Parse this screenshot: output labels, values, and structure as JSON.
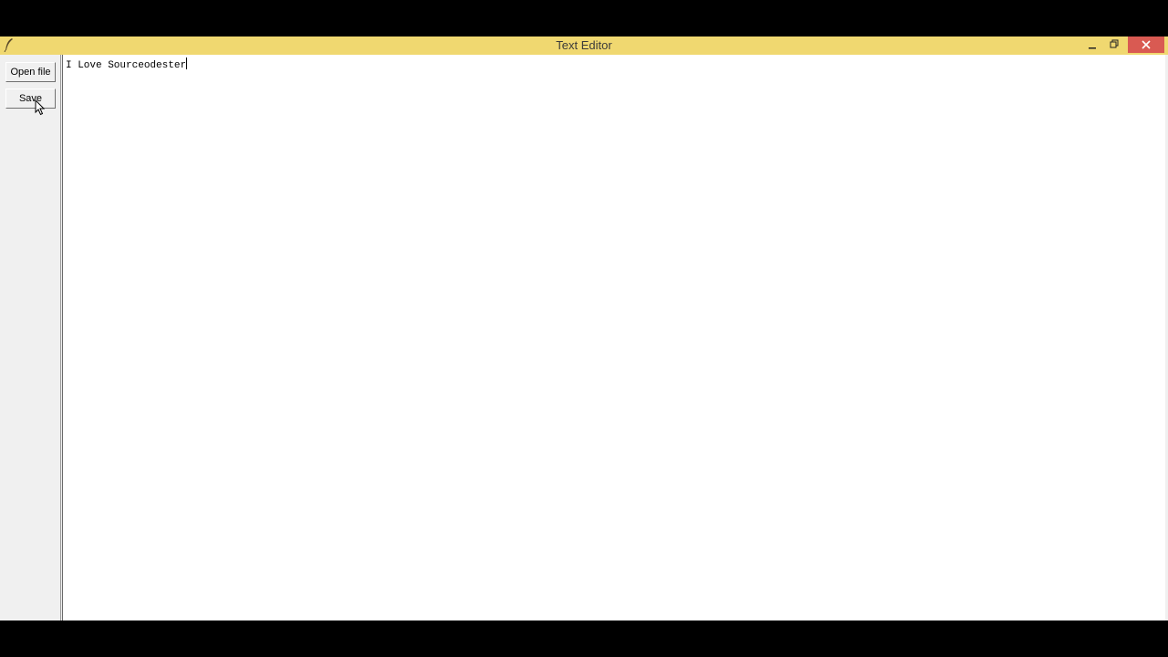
{
  "window": {
    "title": "Text Editor",
    "titlebar_color": "#f0d870",
    "close_color": "#d95a52",
    "controls": {
      "minimize_icon": "minimize-icon",
      "maximize_icon": "restore-icon",
      "close_icon": "close-icon"
    }
  },
  "sidebar": {
    "open_label": "Open file",
    "save_label": "Save"
  },
  "editor": {
    "content": "I Love Sourceodester"
  },
  "icons": {
    "app": "feather-icon",
    "pointer": "mouse-pointer-icon"
  }
}
